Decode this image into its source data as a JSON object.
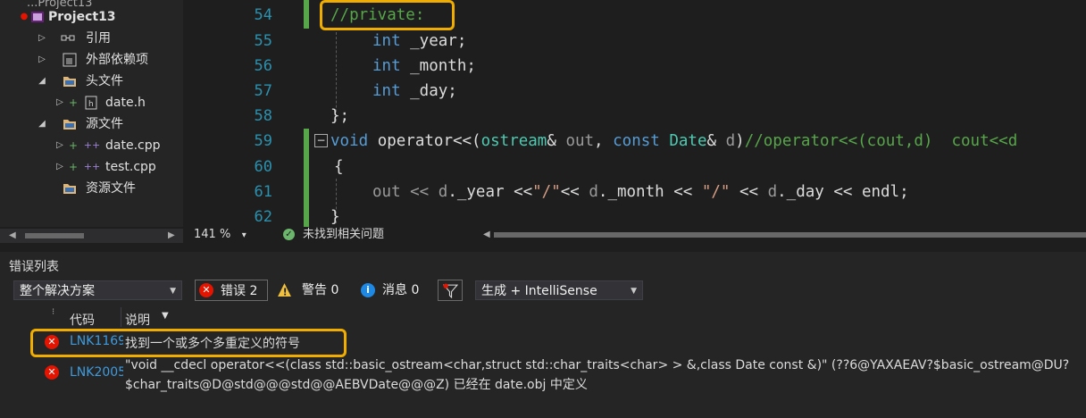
{
  "solution_explorer": {
    "top_partial": "...Project13",
    "project": "Project13",
    "items": [
      {
        "label": "引用",
        "icon": "references-icon"
      },
      {
        "label": "外部依赖项",
        "icon": "external-deps-icon"
      },
      {
        "label": "头文件",
        "icon": "folder-icon"
      },
      {
        "label": "date.h",
        "icon": "header-file-icon"
      },
      {
        "label": "源文件",
        "icon": "folder-icon"
      },
      {
        "label": "date.cpp",
        "icon": "cpp-file-icon"
      },
      {
        "label": "test.cpp",
        "icon": "cpp-file-icon"
      },
      {
        "label": "资源文件",
        "icon": "folder-icon"
      }
    ]
  },
  "editor": {
    "line_numbers": [
      "54",
      "55",
      "56",
      "57",
      "58",
      "59",
      "60",
      "61",
      "62"
    ],
    "lines": {
      "l54": "//private:",
      "l55_kw": "int",
      "l55_id": " _year;",
      "l56_kw": "int",
      "l56_id": " _month;",
      "l57_kw": "int",
      "l57_id": " _day;",
      "l58": "};",
      "l59_void": "void",
      "l59_op": " operator<<(",
      "l59_ostream": "ostream",
      "l59_amp": "& ",
      "l59_out": "out",
      "l59_comma": ", ",
      "l59_const": "const",
      "l59_sp": " ",
      "l59_date": "Date",
      "l59_amp2": "& ",
      "l59_d": "d",
      "l59_close": ")",
      "l59_comment": "//operator<<(cout,d)  cout<<d",
      "l60": "{",
      "l61_out": "out << ",
      "l61_d1": "d",
      "l61_a": "._year <<",
      "l61_s1": "\"/\"",
      "l61_b": "<< ",
      "l61_d2": "d",
      "l61_c": "._month << ",
      "l61_s2": "\"/\"",
      "l61_e": " << ",
      "l61_d3": "d",
      "l61_f": "._day << endl;",
      "l62": "}"
    },
    "zoom": "141 %",
    "zoom_caret": "▾",
    "issues": "未找到相关问题"
  },
  "error_list": {
    "title": "错误列表",
    "scope": "整个解决方案",
    "errors_filter": "错误 2",
    "warnings_filter": "警告 0",
    "messages_filter": "消息 0",
    "build_filter": "生成 + IntelliSense",
    "col_code": "代码",
    "col_desc": "说明",
    "rows": [
      {
        "code": "LNK1169",
        "desc": "找到一个或多个多重定义的符号"
      },
      {
        "code": "LNK2005",
        "desc": "\"void __cdecl operator<<(class std::basic_ostream<char,struct std::char_traits<char> > &,class Date const &)\" (??6@YAXAEAV?$basic_ostream@DU?",
        "desc2": "$char_traits@D@std@@@std@@AEBVDate@@@Z) 已经在 date.obj 中定义"
      }
    ]
  },
  "colors": {
    "highlight": "#f0ad00",
    "error": "#e51400",
    "keyword": "#569cd6",
    "type": "#4ec9b0",
    "comment": "#57a64a"
  }
}
